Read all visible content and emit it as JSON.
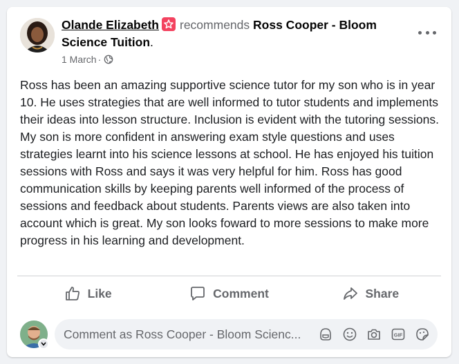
{
  "post": {
    "author": "Olande Elizabeth",
    "verb": "recommends",
    "page_name": "Ross Cooper - Bloom Science Tuition",
    "trailing": ".",
    "date": "1 March",
    "separator": "·",
    "privacy_icon": "globe-icon",
    "more_icon": "more-options-icon",
    "badge_icon": "recommendation-badge-icon",
    "badge_color": "#f3425f",
    "body": "Ross has been an amazing supportive science tutor for my son who is in year 10. He uses strategies that are well informed to tutor students and implements their ideas into lesson structure. Inclusion is evident with the tutoring sessions. My son is more confident in answering exam style questions and uses strategies learnt into his science lessons at school. He has enjoyed his tuition sessions with Ross and says it was very helpful for him. Ross has good communication skills by keeping parents well informed of the process of sessions and feedback about students. Parents views are also taken into account which is great. My son looks foward to more sessions to make more progress in his learning and development."
  },
  "actions": {
    "like": "Like",
    "comment": "Comment",
    "share": "Share"
  },
  "comment_box": {
    "placeholder": "Comment as Ross Cooper - Bloom Scienc...",
    "tools": [
      "avatar-sticker-icon",
      "emoji-icon",
      "camera-icon",
      "gif-icon",
      "sticker-icon"
    ]
  },
  "colors": {
    "text_secondary": "#65676b",
    "card_bg": "#ffffff",
    "page_bg": "#f0f2f5"
  }
}
